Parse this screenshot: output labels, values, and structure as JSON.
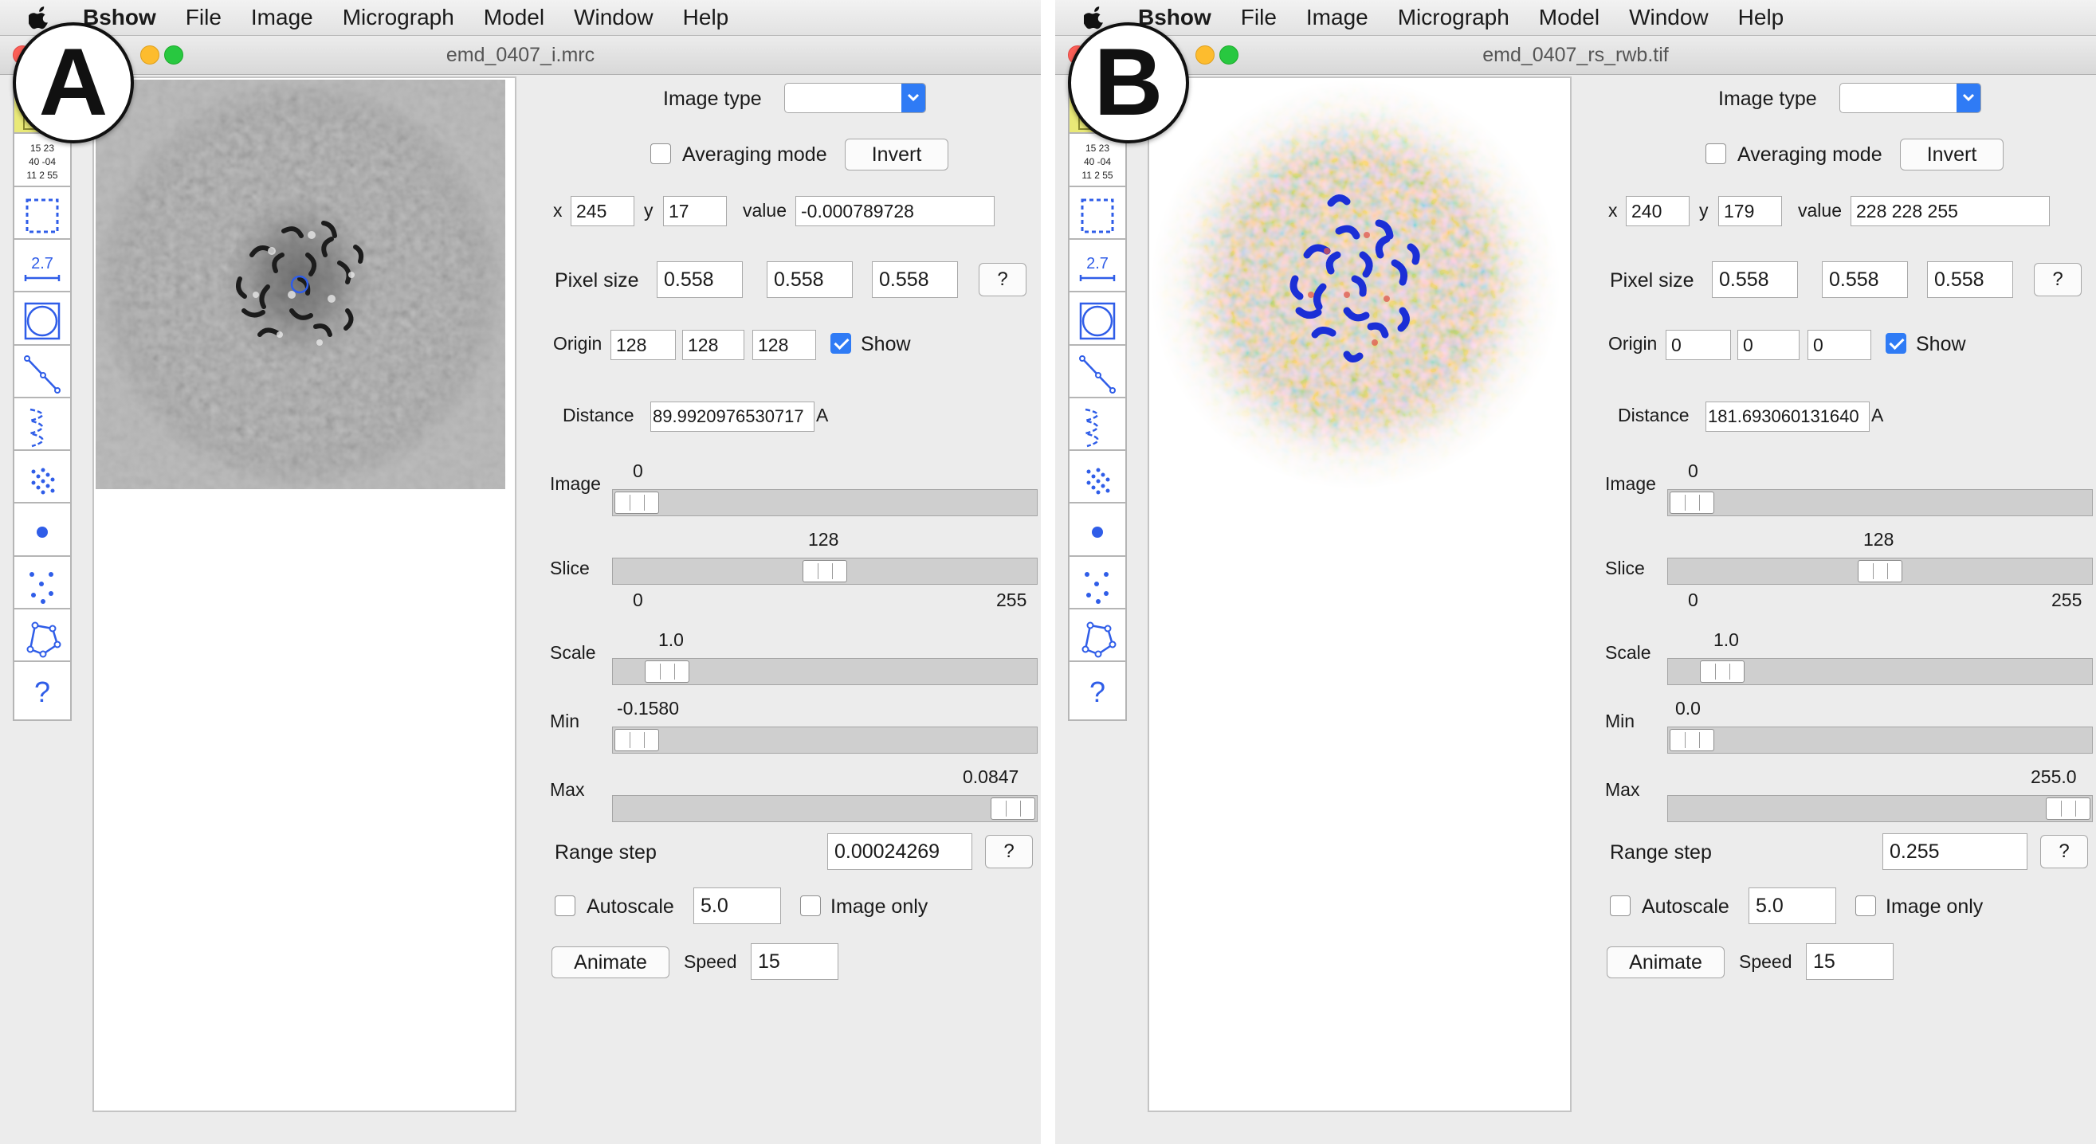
{
  "menubar": {
    "app_name": "Bshow",
    "items": [
      "File",
      "Image",
      "Micrograph",
      "Model",
      "Window",
      "Help"
    ]
  },
  "panels": [
    {
      "badge": "A",
      "window_title": "emd_0407_i.mrc",
      "image_style": "grayscale",
      "image_type_label": "Image type",
      "image_type_value": "",
      "averaging_label": "Averaging mode",
      "averaging_checked": false,
      "invert_label": "Invert",
      "x_label": "x",
      "x_value": "245",
      "y_label": "y",
      "y_value": "17",
      "value_label": "value",
      "value_value": "-0.000789728",
      "pixel_size_label": "Pixel size",
      "pixel_size": [
        "0.558",
        "0.558",
        "0.558"
      ],
      "help_label": "?",
      "origin_label": "Origin",
      "origin": [
        "128",
        "128",
        "128"
      ],
      "show_label": "Show",
      "show_checked": true,
      "distance_label": "Distance",
      "distance_value": "89.9920976530717",
      "distance_unit": "A",
      "image_slider": {
        "label": "Image",
        "value": "0",
        "fraction": 0.0
      },
      "slice_slider": {
        "label": "Slice",
        "value": "128",
        "min": "0",
        "max": "255",
        "fraction": 0.5
      },
      "scale_slider": {
        "label": "Scale",
        "value": "1.0",
        "fraction": 0.08
      },
      "min_slider": {
        "label": "Min",
        "value": "-0.1580",
        "fraction": 0.0
      },
      "max_slider": {
        "label": "Max",
        "value": "0.0847",
        "fraction": 1.0
      },
      "range_step_label": "Range step",
      "range_step_value": "0.00024269",
      "autoscale_label": "Autoscale",
      "autoscale_checked": false,
      "autoscale_value": "5.0",
      "image_only_label": "Image only",
      "image_only_checked": false,
      "animate_label": "Animate",
      "speed_label": "Speed",
      "speed_value": "15"
    },
    {
      "badge": "B",
      "window_title": "emd_0407_rs_rwb.tif",
      "image_style": "red-white-blue",
      "image_type_label": "Image type",
      "image_type_value": "",
      "averaging_label": "Averaging mode",
      "averaging_checked": false,
      "invert_label": "Invert",
      "x_label": "x",
      "x_value": "240",
      "y_label": "y",
      "y_value": "179",
      "value_label": "value",
      "value_value": "228 228 255",
      "pixel_size_label": "Pixel size",
      "pixel_size": [
        "0.558",
        "0.558",
        "0.558"
      ],
      "help_label": "?",
      "origin_label": "Origin",
      "origin": [
        "0",
        "0",
        "0"
      ],
      "show_label": "Show",
      "show_checked": true,
      "distance_label": "Distance",
      "distance_value": "181.693060131640",
      "distance_unit": "A",
      "image_slider": {
        "label": "Image",
        "value": "0",
        "fraction": 0.0
      },
      "slice_slider": {
        "label": "Slice",
        "value": "128",
        "min": "0",
        "max": "255",
        "fraction": 0.5
      },
      "scale_slider": {
        "label": "Scale",
        "value": "1.0",
        "fraction": 0.08
      },
      "min_slider": {
        "label": "Min",
        "value": "0.0",
        "fraction": 0.0
      },
      "max_slider": {
        "label": "Max",
        "value": "255.0",
        "fraction": 1.0
      },
      "range_step_label": "Range step",
      "range_step_value": "0.255",
      "autoscale_label": "Autoscale",
      "autoscale_checked": false,
      "autoscale_value": "5.0",
      "image_only_label": "Image only",
      "image_only_checked": false,
      "animate_label": "Animate",
      "speed_label": "Speed",
      "speed_value": "15"
    }
  ],
  "toolbar_icons": [
    "select-mode-icon",
    "numeric-values-icon",
    "box-select-icon",
    "ruler-measure-icon",
    "circle-mask-icon",
    "line-profile-icon",
    "filament-icon",
    "lattice-icon",
    "point-marker-icon",
    "scatter-points-icon",
    "polygon-model-icon",
    "help-icon"
  ],
  "toolbar_text": {
    "numbers": [
      "15 23",
      "40 -04",
      "11 2 55"
    ],
    "ruler": "2.7",
    "help": "?"
  },
  "colors": {
    "accent_blue": "#2f7bf5",
    "close": "#fc5f57",
    "minimize": "#fdbc2e",
    "maximize": "#28c840",
    "map_red": "#e8706a",
    "map_blue": "#1b2fd6"
  }
}
